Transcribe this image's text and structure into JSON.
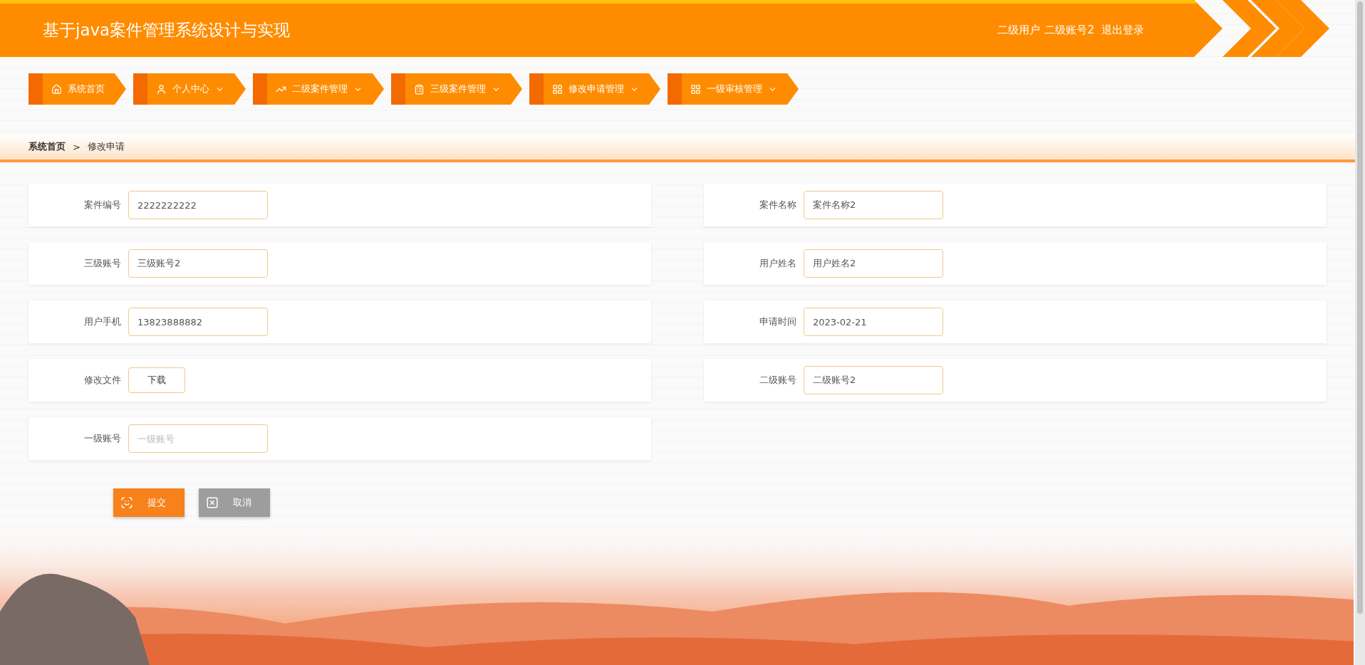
{
  "header": {
    "title": "基于java案件管理系统设计与实现",
    "role": "二级用户",
    "account": "二级账号2",
    "logout": "退出登录"
  },
  "nav": [
    {
      "label": "系统首页",
      "has_menu": false
    },
    {
      "label": "个人中心",
      "has_menu": true
    },
    {
      "label": "二级案件管理",
      "has_menu": true
    },
    {
      "label": "三级案件管理",
      "has_menu": true
    },
    {
      "label": "修改申请管理",
      "has_menu": true
    },
    {
      "label": "一级审核管理",
      "has_menu": true
    }
  ],
  "breadcrumb": {
    "home": "系统首页",
    "separator": ">",
    "current": "修改申请"
  },
  "form": {
    "fields": [
      {
        "label": "案件编号",
        "kind": "input",
        "value": "2222222222"
      },
      {
        "label": "案件名称",
        "kind": "input",
        "value": "案件名称2"
      },
      {
        "label": "三级账号",
        "kind": "input",
        "value": "三级账号2"
      },
      {
        "label": "用户姓名",
        "kind": "input",
        "value": "用户姓名2"
      },
      {
        "label": "用户手机",
        "kind": "input",
        "value": "13823888882"
      },
      {
        "label": "申请时间",
        "kind": "input",
        "value": "2023-02-21"
      },
      {
        "label": "修改文件",
        "kind": "file",
        "button": "下载"
      },
      {
        "label": "二级账号",
        "kind": "input",
        "value": "二级账号2"
      },
      {
        "label": "一级账号",
        "kind": "input",
        "placeholder": "一级账号"
      }
    ],
    "buttons": [
      {
        "label": "提交",
        "kind": "primary"
      },
      {
        "label": "取消",
        "kind": "cancel"
      }
    ]
  }
}
